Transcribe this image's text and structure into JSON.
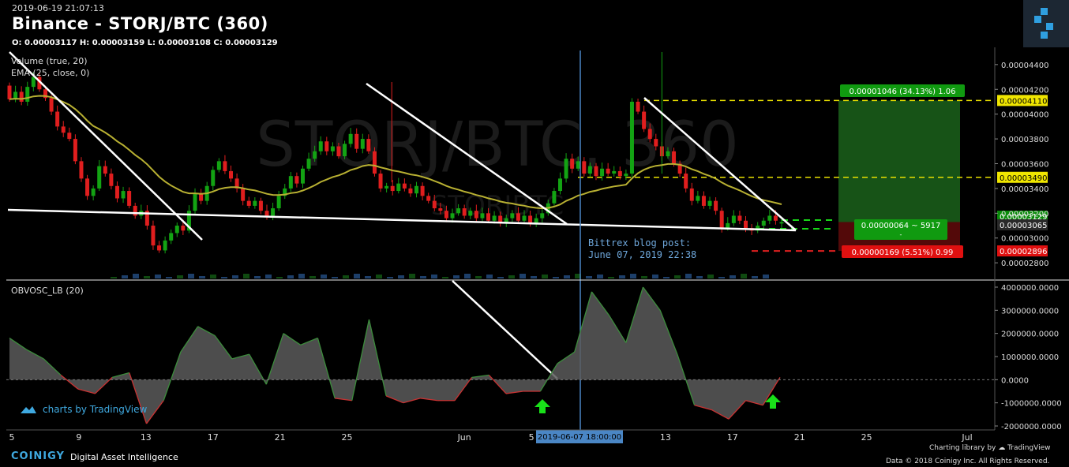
{
  "header": {
    "timestamp": "2019-06-19 21:07:13",
    "title": "Binance - STORJ/BTC (360)",
    "ohlc": "O: 0.00003117 H: 0.00003159 L: 0.00003108 C: 0.00003129"
  },
  "studies": {
    "volume": "Volume (true, 20)",
    "ema": "EMA (25, close, 0)",
    "obv": "OBVOSC_LB (20)"
  },
  "watermark": {
    "main": "STORJ/BTC, 360",
    "sub": "STORJBTC"
  },
  "annotations": {
    "blog_line1": "Bittrex blog post:",
    "blog_line2": "June 07, 2019 22:38",
    "crosshair_date": "2019-06-07 18:00:00",
    "target_box": "0.00001046 (34.13%) 1.06",
    "mid_box": "0.00000064 ~ 5917",
    "mid_box_sub": "-",
    "stop_box": "0.00000169 (5.51%) 0.99"
  },
  "price_tags": {
    "target": "0.00004110",
    "resistance": "0.00003490",
    "current": "0.00003129",
    "low": "0.00003065",
    "stop": "0.00002896"
  },
  "branding": {
    "tv_badge": "charts by TradingView",
    "coinigy": "COINIGY",
    "tagline": "Digital Asset Intelligence",
    "charting": "Charting library by",
    "tv_word": "TradingView",
    "copyright": "Data © 2018  Coinigy Inc. All Rights Reserved."
  },
  "colors": {
    "up": "#13a313",
    "down": "#e01e1e",
    "ema": "#b8b032",
    "trendline": "#ffffff",
    "dashed_target": "#e8e000",
    "dashed_green": "#19d719",
    "dashed_red": "#e02020",
    "target_fill": "#1a5c1a",
    "stop_fill": "#5c0a0a",
    "blog_text": "#6fa8dc",
    "arrow": "#19e019"
  },
  "chart_data": [
    {
      "type": "candlestick",
      "title": "Binance - STORJ/BTC (360)",
      "xlabel": "",
      "ylabel": "",
      "x_ticks": [
        "5",
        "9",
        "13",
        "17",
        "21",
        "25",
        "Jun",
        "5",
        "13",
        "17",
        "21",
        "25",
        "Jul"
      ],
      "y_ticks": [
        "0.00002800",
        "0.00003000",
        "0.00003200",
        "0.00003400",
        "0.00003600",
        "0.00003800",
        "0.00004000",
        "0.00004200",
        "0.00004400"
      ],
      "ylim": [
        2.68e-05,
        4.52e-05
      ],
      "grid": false,
      "x_axis": {
        "start": "2019-05-05",
        "end": "2019-07-01",
        "ticks": [
          "2019-05-05",
          "2019-05-09",
          "2019-05-13",
          "2019-05-17",
          "2019-05-21",
          "2019-05-25",
          "2019-06-01",
          "2019-06-05",
          "2019-06-13",
          "2019-06-17",
          "2019-06-21",
          "2019-06-25",
          "2019-07-01"
        ]
      },
      "series": [
        {
          "name": "Price",
          "points": [
            [
              "2019-05-05",
              4.23,
              4.12
            ],
            [
              "2019-05-05",
              4.12,
              4.18
            ],
            [
              "2019-05-06",
              4.18,
              4.1
            ],
            [
              "2019-05-06",
              4.1,
              4.22
            ],
            [
              "2019-05-06",
              4.22,
              4.3
            ],
            [
              "2019-05-07",
              4.3,
              4.2
            ],
            [
              "2019-05-07",
              4.2,
              4.13
            ],
            [
              "2019-05-07",
              4.13,
              4.02
            ],
            [
              "2019-05-08",
              4.02,
              3.9
            ],
            [
              "2019-05-08",
              3.9,
              3.85
            ],
            [
              "2019-05-08",
              3.85,
              3.8
            ],
            [
              "2019-05-09",
              3.8,
              3.62
            ],
            [
              "2019-05-09",
              3.62,
              3.48
            ],
            [
              "2019-05-09",
              3.48,
              3.34
            ],
            [
              "2019-05-10",
              3.34,
              3.4
            ],
            [
              "2019-05-10",
              3.4,
              3.58
            ],
            [
              "2019-05-10",
              3.58,
              3.52
            ],
            [
              "2019-05-11",
              3.52,
              3.42
            ],
            [
              "2019-05-11",
              3.42,
              3.32
            ],
            [
              "2019-05-11",
              3.32,
              3.38
            ],
            [
              "2019-05-12",
              3.38,
              3.26
            ],
            [
              "2019-05-12",
              3.26,
              3.18
            ],
            [
              "2019-05-12",
              3.18,
              3.22
            ],
            [
              "2019-05-13",
              3.22,
              3.1
            ],
            [
              "2019-05-13",
              3.1,
              2.94
            ],
            [
              "2019-05-13",
              2.94,
              2.9
            ],
            [
              "2019-05-14",
              2.9,
              2.98
            ],
            [
              "2019-05-14",
              2.98,
              3.04
            ],
            [
              "2019-05-14",
              3.04,
              3.1
            ],
            [
              "2019-05-15",
              3.1,
              3.06
            ],
            [
              "2019-05-15",
              3.06,
              3.22
            ],
            [
              "2019-05-15",
              3.22,
              3.36
            ],
            [
              "2019-05-16",
              3.36,
              3.3
            ],
            [
              "2019-05-16",
              3.3,
              3.42
            ],
            [
              "2019-05-16",
              3.42,
              3.55
            ],
            [
              "2019-05-17",
              3.55,
              3.62
            ],
            [
              "2019-05-17",
              3.62,
              3.54
            ],
            [
              "2019-05-17",
              3.54,
              3.48
            ],
            [
              "2019-05-18",
              3.48,
              3.4
            ],
            [
              "2019-05-18",
              3.4,
              3.3
            ],
            [
              "2019-05-18",
              3.3,
              3.26
            ],
            [
              "2019-05-19",
              3.26,
              3.3
            ],
            [
              "2019-05-19",
              3.3,
              3.22
            ],
            [
              "2019-05-19",
              3.22,
              3.18
            ],
            [
              "2019-05-20",
              3.18,
              3.24
            ],
            [
              "2019-05-20",
              3.24,
              3.34
            ],
            [
              "2019-05-20",
              3.34,
              3.4
            ],
            [
              "2019-05-21",
              3.4,
              3.5
            ],
            [
              "2019-05-21",
              3.5,
              3.44
            ],
            [
              "2019-05-21",
              3.44,
              3.56
            ],
            [
              "2019-05-22",
              3.56,
              3.64
            ],
            [
              "2019-05-22",
              3.64,
              3.7
            ],
            [
              "2019-05-22",
              3.7,
              3.78
            ],
            [
              "2019-05-23",
              3.78,
              3.7
            ],
            [
              "2019-05-23",
              3.7,
              3.74
            ],
            [
              "2019-05-23",
              3.74,
              3.66
            ],
            [
              "2019-05-24",
              3.66,
              3.76
            ],
            [
              "2019-05-24",
              3.76,
              3.84
            ],
            [
              "2019-05-24",
              3.84,
              3.72
            ],
            [
              "2019-05-25",
              3.72,
              3.8
            ],
            [
              "2019-05-25",
              3.8,
              3.7
            ],
            [
              "2019-05-25",
              3.7,
              3.52
            ],
            [
              "2019-05-26",
              3.52,
              3.4
            ],
            [
              "2019-05-26",
              3.4,
              3.42
            ],
            [
              "2019-05-26",
              3.42,
              3.38
            ],
            [
              "2019-05-27",
              3.38,
              3.44
            ],
            [
              "2019-05-27",
              3.44,
              3.4
            ],
            [
              "2019-05-27",
              3.4,
              3.36
            ],
            [
              "2019-05-28",
              3.36,
              3.42
            ],
            [
              "2019-05-28",
              3.42,
              3.34
            ],
            [
              "2019-05-28",
              3.34,
              3.3
            ],
            [
              "2019-05-29",
              3.3,
              3.24
            ],
            [
              "2019-05-29",
              3.24,
              3.22
            ],
            [
              "2019-05-29",
              3.22,
              3.16
            ],
            [
              "2019-05-30",
              3.16,
              3.2
            ],
            [
              "2019-05-30",
              3.2,
              3.24
            ],
            [
              "2019-05-30",
              3.24,
              3.18
            ],
            [
              "2019-05-31",
              3.18,
              3.22
            ],
            [
              "2019-05-31",
              3.22,
              3.16
            ],
            [
              "2019-05-31",
              3.16,
              3.2
            ],
            [
              "2019-06-01",
              3.2,
              3.14
            ],
            [
              "2019-06-01",
              3.14,
              3.18
            ],
            [
              "2019-06-02",
              3.18,
              3.12
            ],
            [
              "2019-06-02",
              3.12,
              3.16
            ],
            [
              "2019-06-03",
              3.16,
              3.2
            ],
            [
              "2019-06-03",
              3.2,
              3.14
            ],
            [
              "2019-06-04",
              3.14,
              3.18
            ],
            [
              "2019-06-04",
              3.18,
              3.12
            ],
            [
              "2019-06-05",
              3.12,
              3.16
            ],
            [
              "2019-06-05",
              3.16,
              3.2
            ],
            [
              "2019-06-06",
              3.2,
              3.28
            ],
            [
              "2019-06-06",
              3.28,
              3.38
            ],
            [
              "2019-06-07",
              3.38,
              3.48
            ],
            [
              "2019-06-07",
              3.48,
              3.64
            ],
            [
              "2019-06-07",
              3.64,
              3.56
            ],
            [
              "2019-06-08",
              3.56,
              3.62
            ],
            [
              "2019-06-08",
              3.62,
              3.52
            ],
            [
              "2019-06-08",
              3.52,
              3.58
            ],
            [
              "2019-06-09",
              3.58,
              3.5
            ],
            [
              "2019-06-09",
              3.5,
              3.56
            ],
            [
              "2019-06-09",
              3.56,
              3.52
            ],
            [
              "2019-06-10",
              3.52,
              3.54
            ],
            [
              "2019-06-10",
              3.54,
              3.5
            ],
            [
              "2019-06-10",
              3.5,
              3.52
            ],
            [
              "2019-06-11",
              3.52,
              4.1
            ],
            [
              "2019-06-11",
              4.1,
              4.02
            ],
            [
              "2019-06-11",
              4.02,
              3.88
            ],
            [
              "2019-06-12",
              3.88,
              3.8
            ],
            [
              "2019-06-12",
              3.8,
              3.74
            ],
            [
              "2019-06-12",
              3.74,
              3.66
            ],
            [
              "2019-06-13",
              3.66,
              3.7
            ],
            [
              "2019-06-13",
              3.7,
              3.6
            ],
            [
              "2019-06-13",
              3.6,
              3.52
            ],
            [
              "2019-06-14",
              3.52,
              3.4
            ],
            [
              "2019-06-14",
              3.4,
              3.3
            ],
            [
              "2019-06-14",
              3.3,
              3.34
            ],
            [
              "2019-06-15",
              3.34,
              3.26
            ],
            [
              "2019-06-15",
              3.26,
              3.3
            ],
            [
              "2019-06-15",
              3.3,
              3.22
            ],
            [
              "2019-06-16",
              3.22,
              3.08
            ],
            [
              "2019-06-16",
              3.08,
              3.12
            ],
            [
              "2019-06-16",
              3.12,
              3.18
            ],
            [
              "2019-06-17",
              3.18,
              3.14
            ],
            [
              "2019-06-17",
              3.14,
              3.08
            ],
            [
              "2019-06-17",
              3.08,
              3.06
            ],
            [
              "2019-06-18",
              3.06,
              3.1
            ],
            [
              "2019-06-18",
              3.1,
              3.14
            ],
            [
              "2019-06-18",
              3.14,
              3.18
            ],
            [
              "2019-06-19",
              3.18,
              3.14
            ],
            [
              "2019-06-19",
              3.117,
              3.129
            ]
          ]
        }
      ],
      "candle_scale": "price × 1e-5 BTC (open, close)",
      "levels": {
        "target": 4.11e-05,
        "resistance": 3.49e-05,
        "current": 3.129e-05,
        "low": 3.065e-05,
        "stop": 2.896e-05
      }
    },
    {
      "type": "area",
      "title": "OBVOSC_LB (20)",
      "xlabel": "",
      "ylabel": "",
      "y_ticks": [
        "-2000000.0000",
        "-1000000.0000",
        "0.0000",
        "1000000.0000",
        "2000000.0000",
        "3000000.0000",
        "4000000.0000"
      ],
      "ylim": [
        -2000000,
        4000000
      ],
      "grid": false,
      "series": [
        {
          "name": "OBVOSC_LB",
          "x": [
            "2019-05-05",
            "2019-05-06",
            "2019-05-07",
            "2019-05-08",
            "2019-05-09",
            "2019-05-10",
            "2019-05-11",
            "2019-05-12",
            "2019-05-13",
            "2019-05-14",
            "2019-05-15",
            "2019-05-16",
            "2019-05-17",
            "2019-05-18",
            "2019-05-19",
            "2019-05-20",
            "2019-05-21",
            "2019-05-22",
            "2019-05-23",
            "2019-05-24",
            "2019-05-25",
            "2019-05-26",
            "2019-05-27",
            "2019-05-28",
            "2019-05-29",
            "2019-05-30",
            "2019-05-31",
            "2019-06-01",
            "2019-06-02",
            "2019-06-03",
            "2019-06-04",
            "2019-06-05",
            "2019-06-06",
            "2019-06-07",
            "2019-06-08",
            "2019-06-09",
            "2019-06-10",
            "2019-06-11",
            "2019-06-12",
            "2019-06-13",
            "2019-06-14",
            "2019-06-15",
            "2019-06-16",
            "2019-06-17",
            "2019-06-18",
            "2019-06-19"
          ],
          "values": [
            1800000,
            1300000,
            900000,
            200000,
            -400000,
            -600000,
            100000,
            300000,
            -1900000,
            -900000,
            1200000,
            2300000,
            1900000,
            900000,
            1100000,
            -200000,
            2000000,
            1500000,
            1800000,
            -800000,
            -900000,
            2600000,
            -700000,
            -1000000,
            -800000,
            -900000,
            -900000,
            100000,
            200000,
            -600000,
            -500000,
            -500000,
            700000,
            1200000,
            3800000,
            2800000,
            1600000,
            4000000,
            3000000,
            1100000,
            -1100000,
            -1300000,
            -1700000,
            -900000,
            -1100000,
            100000
          ]
        }
      ]
    }
  ]
}
